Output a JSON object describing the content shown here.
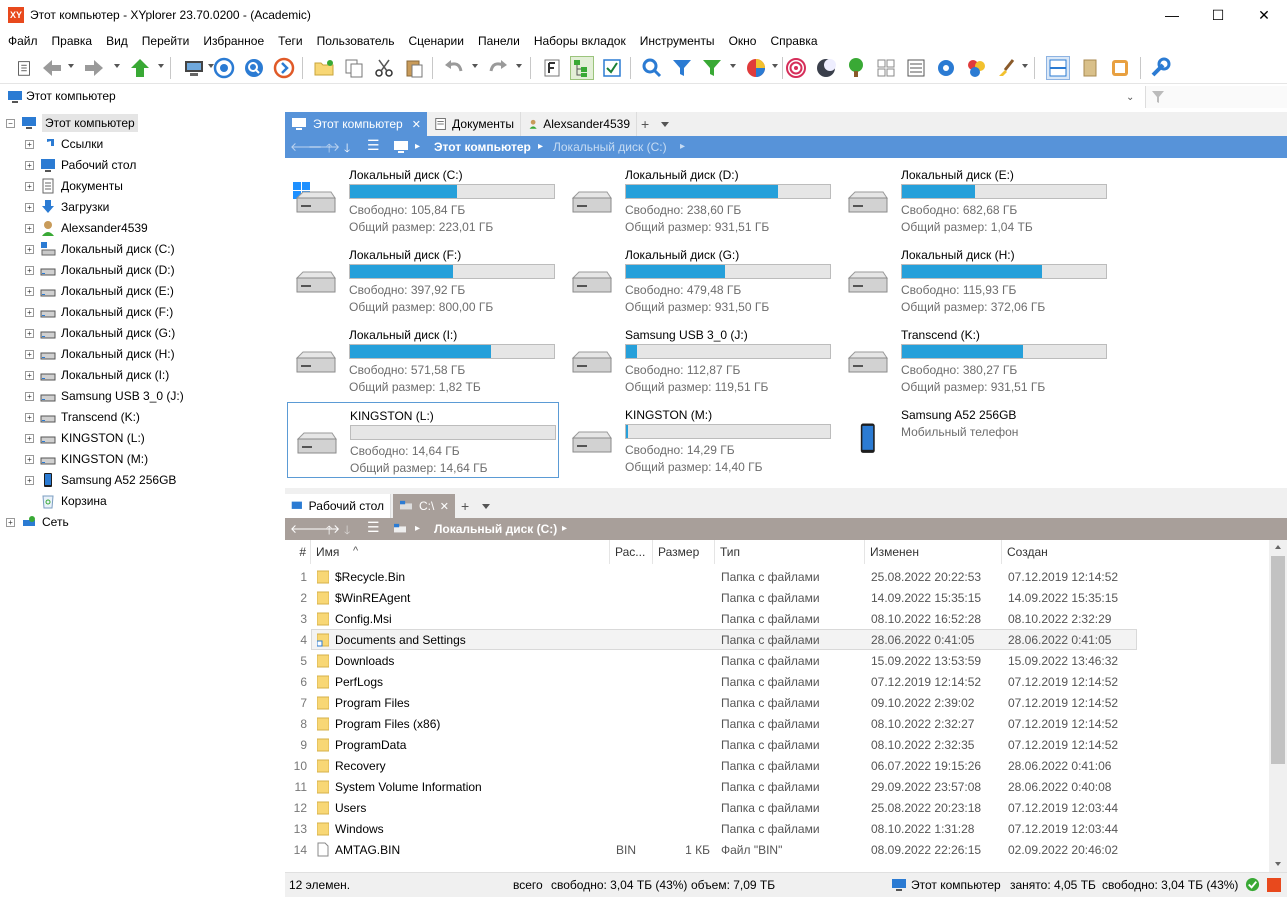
{
  "window": {
    "title": "Этот компьютер - XYplorer 23.70.0200 - (Academic)",
    "logo": "XY",
    "controls": [
      "—",
      "☐",
      "✕"
    ]
  },
  "menu": [
    "Файл",
    "Правка",
    "Вид",
    "Перейти",
    "Избранное",
    "Теги",
    "Пользователь",
    "Сценарии",
    "Панели",
    "Наборы вкладок",
    "Инструменты",
    "Окно",
    "Справка"
  ],
  "address": {
    "text": "Этот компьютер"
  },
  "tree": {
    "root": "Этот компьютер",
    "items": [
      "Ссылки",
      "Рабочий стол",
      "Документы",
      "Загрузки",
      "Alexsander4539",
      "Локальный диск (C:)",
      "Локальный диск (D:)",
      "Локальный диск (E:)",
      "Локальный диск (F:)",
      "Локальный диск (G:)",
      "Локальный диск (H:)",
      "Локальный диск (I:)",
      "Samsung USB 3_0 (J:)",
      "Transcend (K:)",
      "KINGSTON (L:)",
      "KINGSTON (M:)",
      "Samsung A52 256GB",
      "Корзина"
    ],
    "network": "Сеть"
  },
  "top_pane": {
    "tabs": [
      "Этот компьютер",
      "Документы",
      "Alexsander4539"
    ],
    "breadcrumb": [
      "Этот компьютер",
      "Локальный диск (C:)"
    ],
    "drives": [
      {
        "name": "Локальный диск (C:)",
        "free": "Свободно: 105,84 ГБ",
        "total": "Общий размер: 223,01 ГБ",
        "used_fraction": 0.525
      },
      {
        "name": "Локальный диск (D:)",
        "free": "Свободно: 238,60 ГБ",
        "total": "Общий размер: 931,51 ГБ",
        "used_fraction": 0.744
      },
      {
        "name": "Локальный диск (E:)",
        "free": "Свободно: 682,68 ГБ",
        "total": "Общий размер: 1,04 ТБ",
        "used_fraction": 0.359
      },
      {
        "name": "Локальный диск (F:)",
        "free": "Свободно: 397,92 ГБ",
        "total": "Общий размер: 800,00 ГБ",
        "used_fraction": 0.503
      },
      {
        "name": "Локальный диск (G:)",
        "free": "Свободно: 479,48 ГБ",
        "total": "Общий размер: 931,50 ГБ",
        "used_fraction": 0.485
      },
      {
        "name": "Локальный диск (H:)",
        "free": "Свободно: 115,93 ГБ",
        "total": "Общий размер: 372,06 ГБ",
        "used_fraction": 0.688
      },
      {
        "name": "Локальный диск (I:)",
        "free": "Свободно: 571,58 ГБ",
        "total": "Общий размер: 1,82 ТБ",
        "used_fraction": 0.693
      },
      {
        "name": "Samsung USB 3_0 (J:)",
        "free": "Свободно: 112,87 ГБ",
        "total": "Общий размер: 119,51 ГБ",
        "used_fraction": 0.056
      },
      {
        "name": "Transcend (K:)",
        "free": "Свободно: 380,27 ГБ",
        "total": "Общий размер: 931,51 ГБ",
        "used_fraction": 0.592
      },
      {
        "name": "KINGSTON (L:)",
        "free": "Свободно: 14,64 ГБ",
        "total": "Общий размер: 14,64 ГБ",
        "used_fraction": 0.0
      },
      {
        "name": "KINGSTON (M:)",
        "free": "Свободно: 14,29 ГБ",
        "total": "Общий размер: 14,40 ГБ",
        "used_fraction": 0.008
      },
      {
        "name": "Samsung A52 256GB",
        "free": "Мобильный телефон",
        "total": "",
        "used_fraction": null
      }
    ]
  },
  "bottom_pane": {
    "tabs": [
      "Рабочий стол",
      "C:\\"
    ],
    "breadcrumb": [
      "Локальный диск (C:)"
    ],
    "columns": [
      "#",
      "Имя",
      "Рас...",
      "Размер",
      "Тип",
      "Изменен",
      "Создан"
    ],
    "rows": [
      {
        "n": "1",
        "name": "$Recycle.Bin",
        "ext": "",
        "size": "",
        "type": "Папка с файлами",
        "modified": "25.08.2022 20:22:53",
        "created": "07.12.2019 12:14:52"
      },
      {
        "n": "2",
        "name": "$WinREAgent",
        "ext": "",
        "size": "",
        "type": "Папка с файлами",
        "modified": "14.09.2022 15:35:15",
        "created": "14.09.2022 15:35:15"
      },
      {
        "n": "3",
        "name": "Config.Msi",
        "ext": "",
        "size": "",
        "type": "Папка с файлами",
        "modified": "08.10.2022 16:52:28",
        "created": "08.10.2022 2:32:29"
      },
      {
        "n": "4",
        "name": "Documents and Settings",
        "ext": "",
        "size": "",
        "type": "Папка с файлами",
        "modified": "28.06.2022 0:41:05",
        "created": "28.06.2022 0:41:05"
      },
      {
        "n": "5",
        "name": "Downloads",
        "ext": "",
        "size": "",
        "type": "Папка с файлами",
        "modified": "15.09.2022 13:53:59",
        "created": "15.09.2022 13:46:32"
      },
      {
        "n": "6",
        "name": "PerfLogs",
        "ext": "",
        "size": "",
        "type": "Папка с файлами",
        "modified": "07.12.2019 12:14:52",
        "created": "07.12.2019 12:14:52"
      },
      {
        "n": "7",
        "name": "Program Files",
        "ext": "",
        "size": "",
        "type": "Папка с файлами",
        "modified": "09.10.2022 2:39:02",
        "created": "07.12.2019 12:14:52"
      },
      {
        "n": "8",
        "name": "Program Files (x86)",
        "ext": "",
        "size": "",
        "type": "Папка с файлами",
        "modified": "08.10.2022 2:32:27",
        "created": "07.12.2019 12:14:52"
      },
      {
        "n": "9",
        "name": "ProgramData",
        "ext": "",
        "size": "",
        "type": "Папка с файлами",
        "modified": "08.10.2022 2:32:35",
        "created": "07.12.2019 12:14:52"
      },
      {
        "n": "10",
        "name": "Recovery",
        "ext": "",
        "size": "",
        "type": "Папка с файлами",
        "modified": "06.07.2022 19:15:26",
        "created": "28.06.2022 0:41:06"
      },
      {
        "n": "11",
        "name": "System Volume Information",
        "ext": "",
        "size": "",
        "type": "Папка с файлами",
        "modified": "29.09.2022 23:57:08",
        "created": "28.06.2022 0:40:08"
      },
      {
        "n": "12",
        "name": "Users",
        "ext": "",
        "size": "",
        "type": "Папка с файлами",
        "modified": "25.08.2022 20:23:18",
        "created": "07.12.2019 12:03:44"
      },
      {
        "n": "13",
        "name": "Windows",
        "ext": "",
        "size": "",
        "type": "Папка с файлами",
        "modified": "08.10.2022 1:31:28",
        "created": "07.12.2019 12:03:44"
      },
      {
        "n": "14",
        "name": "AMTAG.BIN",
        "ext": "BIN",
        "size": "1 КБ",
        "type": "Файл \"BIN\"",
        "modified": "08.09.2022 22:26:15",
        "created": "02.09.2022 20:46:02"
      }
    ]
  },
  "status": {
    "count": "12 элемен.",
    "total": "всего",
    "free": "свободно: 3,04 ТБ (43%)",
    "volume": "объем: 7,09 ТБ",
    "location": "Этот компьютер",
    "used": "занято: 4,05 ТБ",
    "free2": "свободно: 3,04 ТБ (43%)"
  },
  "colors": {
    "accent": "#5793d9",
    "bar": "#26a0da",
    "inactive_crumb": "#a89f9a",
    "folder": "#f8d775"
  }
}
